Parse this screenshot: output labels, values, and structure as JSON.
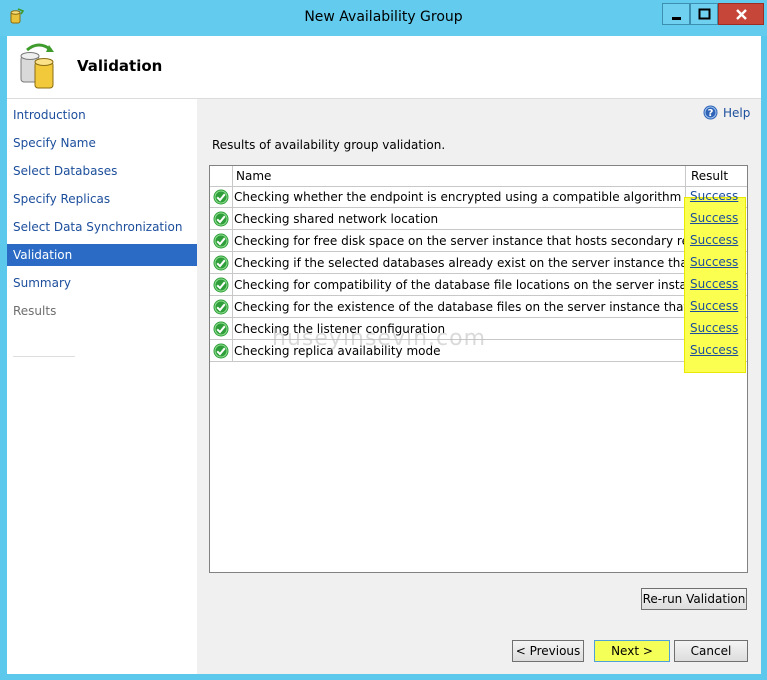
{
  "window": {
    "title": "New Availability Group"
  },
  "header": {
    "title": "Validation"
  },
  "sidebar": {
    "items": [
      {
        "label": "Introduction",
        "state": "link"
      },
      {
        "label": "Specify Name",
        "state": "link"
      },
      {
        "label": "Select Databases",
        "state": "link"
      },
      {
        "label": "Specify Replicas",
        "state": "link"
      },
      {
        "label": "Select Data Synchronization",
        "state": "link"
      },
      {
        "label": "Validation",
        "state": "active"
      },
      {
        "label": "Summary",
        "state": "link"
      },
      {
        "label": "Results",
        "state": "disabled"
      }
    ]
  },
  "help": {
    "label": "Help",
    "icon": "help-icon"
  },
  "main": {
    "heading": "Results of availability group validation.",
    "columns": {
      "name": "Name",
      "result": "Result"
    },
    "rows": [
      {
        "name": "Checking whether the endpoint is encrypted using a compatible algorithm",
        "result": "Success"
      },
      {
        "name": "Checking shared network location",
        "result": "Success"
      },
      {
        "name": "Checking for free disk space on the server instance that hosts secondary replica NB...",
        "result": "Success"
      },
      {
        "name": "Checking if the selected databases already exist on the server instance that hosts se...",
        "result": "Success"
      },
      {
        "name": "Checking for compatibility of the database file locations on the server instance that...",
        "result": "Success"
      },
      {
        "name": "Checking for the existence of the database files on the server instance that hosts se...",
        "result": "Success"
      },
      {
        "name": "Checking the listener configuration",
        "result": "Success"
      },
      {
        "name": "Checking replica availability mode",
        "result": "Success"
      }
    ],
    "watermark": "huseyinsevin.com"
  },
  "buttons": {
    "rerun": "Re-run Validation",
    "previous": "< Previous",
    "next": "Next >",
    "cancel": "Cancel"
  },
  "colors": {
    "titlebar": "#62cbee",
    "link": "#1c4e9c",
    "active_nav": "#2b6bc5",
    "highlight": "#fbff4f",
    "success_icon": "#2f9e3a"
  }
}
